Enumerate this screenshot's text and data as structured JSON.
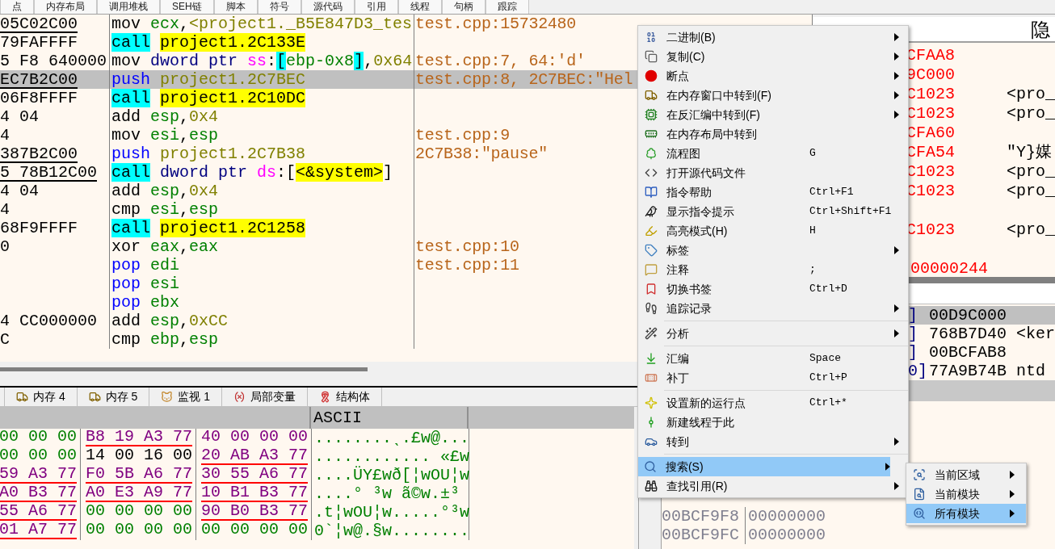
{
  "top_tabs": [
    {
      "label": "点"
    },
    {
      "label": "内存布局"
    },
    {
      "label": "调用堆栈"
    },
    {
      "label": "SEH链"
    },
    {
      "label": "脚本"
    },
    {
      "label": "符号"
    },
    {
      "label": "源代码"
    },
    {
      "label": "引用"
    },
    {
      "label": "线程"
    },
    {
      "label": "句柄"
    },
    {
      "label": "跟踪"
    }
  ],
  "disassembly": [
    {
      "bytes": "05C02C00",
      "underlined": true,
      "selected": false,
      "comment": "test.cpp:15732480",
      "parts": [
        {
          "text": "mov ",
          "kind": "op"
        },
        {
          "text": "ecx",
          "kind": "reg"
        },
        {
          "text": ",",
          "kind": "punct"
        },
        {
          "text": "<project1._B5E847D3_tes",
          "kind": "sym"
        }
      ]
    },
    {
      "bytes": "79FAFFFF",
      "underlined": false,
      "selected": false,
      "parts": [
        {
          "text": "call",
          "kind": "call"
        },
        {
          "text": "project1.2C133E",
          "kind": "target"
        }
      ]
    },
    {
      "bytes": "5 F8 640000",
      "underlined": false,
      "selected": false,
      "comment": "test.cpp:7, 64:'d'",
      "parts": [
        {
          "text": "mov ",
          "kind": "op"
        },
        {
          "text": "dword ptr ",
          "kind": "size"
        },
        {
          "text": "ss",
          "kind": "seg"
        },
        {
          "text": ":",
          "kind": "punct"
        },
        {
          "text": "[",
          "kind": "hl"
        },
        {
          "text": "ebp-0x8",
          "kind": "reg"
        },
        {
          "text": "]",
          "kind": "hl"
        },
        {
          "text": ",",
          "kind": "punct"
        },
        {
          "text": "0x64",
          "kind": "num"
        }
      ]
    },
    {
      "bytes": "EC7B2C00",
      "underlined": true,
      "selected": true,
      "comment": "test.cpp:8, 2C7BEC:\"Hel",
      "parts": [
        {
          "text": "push ",
          "kind": "stack"
        },
        {
          "text": "project1.2C7BEC",
          "kind": "sym"
        }
      ]
    },
    {
      "bytes": "06F8FFFF",
      "underlined": false,
      "selected": false,
      "parts": [
        {
          "text": "call",
          "kind": "call"
        },
        {
          "text": "project1.2C10DC",
          "kind": "target"
        }
      ]
    },
    {
      "bytes": "4 04",
      "underlined": false,
      "selected": false,
      "parts": [
        {
          "text": "add ",
          "kind": "op"
        },
        {
          "text": "esp",
          "kind": "reg"
        },
        {
          "text": ",",
          "kind": "punct"
        },
        {
          "text": "0x4",
          "kind": "num"
        }
      ]
    },
    {
      "bytes": "4",
      "underlined": false,
      "selected": false,
      "comment": "test.cpp:9",
      "parts": [
        {
          "text": "mov ",
          "kind": "op"
        },
        {
          "text": "esi",
          "kind": "reg"
        },
        {
          "text": ",",
          "kind": "punct"
        },
        {
          "text": "esp",
          "kind": "reg"
        }
      ]
    },
    {
      "bytes": "387B2C00",
      "underlined": true,
      "selected": false,
      "comment": "2C7B38:\"pause\"",
      "parts": [
        {
          "text": "push ",
          "kind": "stack"
        },
        {
          "text": "project1.2C7B38",
          "kind": "sym"
        }
      ]
    },
    {
      "bytes": "5 78B12C00",
      "underlined": true,
      "selected": false,
      "parts": [
        {
          "text": "call",
          "kind": "call"
        },
        {
          "text": "dword ptr ",
          "kind": "size"
        },
        {
          "text": "ds",
          "kind": "seg"
        },
        {
          "text": ":[",
          "kind": "punct"
        },
        {
          "text": "<&system>",
          "kind": "target"
        },
        {
          "text": "]",
          "kind": "punct"
        }
      ]
    },
    {
      "bytes": "4 04",
      "underlined": false,
      "selected": false,
      "parts": [
        {
          "text": "add ",
          "kind": "op"
        },
        {
          "text": "esp",
          "kind": "reg"
        },
        {
          "text": ",",
          "kind": "punct"
        },
        {
          "text": "0x4",
          "kind": "num"
        }
      ]
    },
    {
      "bytes": "4",
      "underlined": false,
      "selected": false,
      "parts": [
        {
          "text": "cmp ",
          "kind": "op"
        },
        {
          "text": "esi",
          "kind": "reg"
        },
        {
          "text": ",",
          "kind": "punct"
        },
        {
          "text": "esp",
          "kind": "reg"
        }
      ]
    },
    {
      "bytes": "68F9FFFF",
      "underlined": false,
      "selected": false,
      "parts": [
        {
          "text": "call",
          "kind": "call"
        },
        {
          "text": "project1.2C1258",
          "kind": "target"
        }
      ]
    },
    {
      "bytes": "0",
      "underlined": false,
      "selected": false,
      "comment": "test.cpp:10",
      "parts": [
        {
          "text": "xor ",
          "kind": "op"
        },
        {
          "text": "eax",
          "kind": "reg"
        },
        {
          "text": ",",
          "kind": "punct"
        },
        {
          "text": "eax",
          "kind": "reg"
        }
      ]
    },
    {
      "selected": false,
      "comment": "test.cpp:11",
      "parts": [
        {
          "text": "pop ",
          "kind": "stack"
        },
        {
          "text": "edi",
          "kind": "reg"
        }
      ]
    },
    {
      "selected": false,
      "parts": [
        {
          "text": "pop ",
          "kind": "stack"
        },
        {
          "text": "esi",
          "kind": "reg"
        }
      ]
    },
    {
      "selected": false,
      "parts": [
        {
          "text": "pop ",
          "kind": "stack"
        },
        {
          "text": "ebx",
          "kind": "reg"
        }
      ]
    },
    {
      "bytes": "4 CC000000",
      "underlined": false,
      "selected": false,
      "parts": [
        {
          "text": "add ",
          "kind": "op"
        },
        {
          "text": "esp",
          "kind": "reg"
        },
        {
          "text": ",",
          "kind": "punct"
        },
        {
          "text": "0xCC",
          "kind": "num"
        }
      ]
    },
    {
      "bytes": "C",
      "underlined": false,
      "selected": false,
      "parts": [
        {
          "text": "cmp ",
          "kind": "op"
        },
        {
          "text": "ebp",
          "kind": "reg"
        },
        {
          "text": ",",
          "kind": "punct"
        },
        {
          "text": "esp",
          "kind": "reg"
        }
      ]
    }
  ],
  "dump_tabs": [
    {
      "label": "内存 4",
      "selected": false
    },
    {
      "label": "内存 5",
      "selected": false
    },
    {
      "label": "监视 1",
      "selected": false
    },
    {
      "label": "局部变量",
      "selected": false
    },
    {
      "label": "结构体",
      "selected": false
    }
  ],
  "dump": {
    "ascii_header": "ASCII",
    "rows": [
      {
        "groups": [
          {
            "text": "00 00 00",
            "kind": "zero"
          },
          {
            "text": "B8 19 A3 77",
            "kind": "pointer"
          },
          {
            "text": "40 00 00 00",
            "kind": "lead"
          }
        ],
        "ascii": "........ˎ.£w@..."
      },
      {
        "groups": [
          {
            "text": "00 00 00",
            "kind": "zero"
          },
          {
            "text": "14 00 16 00",
            "kind": "data"
          },
          {
            "text": "20 AB A3 77",
            "kind": "pointer"
          }
        ],
        "ascii": "............ «£w"
      },
      {
        "groups": [
          {
            "text": "59 A3 77",
            "kind": "pointer"
          },
          {
            "text": "F0 5B A6 77",
            "kind": "pointer"
          },
          {
            "text": "30 55 A6 77",
            "kind": "pointer"
          }
        ],
        "ascii": "....ÜY£wð[¦wOU¦w"
      },
      {
        "groups": [
          {
            "text": "A0 B3 77",
            "kind": "pointer"
          },
          {
            "text": "A0 E3 A9 77",
            "kind": "pointer"
          },
          {
            "text": "10 B1 B3 77",
            "kind": "pointer"
          }
        ],
        "ascii": "....° ³w ã©w.±³"
      },
      {
        "groups": [
          {
            "text": "55 A6 77",
            "kind": "pointer"
          },
          {
            "text": "00 00 00 00",
            "kind": "zero"
          },
          {
            "text": "90 B0 B3 77",
            "kind": "pointer"
          }
        ],
        "ascii": ".t¦wOU¦w.....°³w"
      },
      {
        "groups": [
          {
            "text": "01 A7 77",
            "kind": "pointer"
          },
          {
            "text": "00 00 00 00",
            "kind": "zero"
          },
          {
            "text": "00 00 00 00",
            "kind": "zero"
          }
        ],
        "ascii": "0`¦w@.§w........"
      }
    ]
  },
  "registers": {
    "header": "隐",
    "rows": [
      {
        "value": "CFAA8"
      },
      {
        "value": "9C000"
      },
      {
        "value": "C1023",
        "comment": "<pro_"
      },
      {
        "value": "C1023",
        "comment": "<pro_"
      },
      {
        "value": "CFA60"
      },
      {
        "value": "CFA54",
        "comment": "\"Y}媒"
      },
      {
        "value": "C1023",
        "comment": "<pro_"
      },
      {
        "value": "C1023",
        "comment": "<pro_"
      },
      {
        "blank": true
      },
      {
        "value": "C1023",
        "comment": "<pro_"
      },
      {
        "blank": true
      },
      {
        "value": "00000244"
      }
    ]
  },
  "stack_top": {
    "rows": [
      {
        "prefix": "]",
        "value": "00D9C000",
        "selected": true
      },
      {
        "prefix": "]",
        "value": "768B7D40",
        "comment": "<ker",
        "selected": false
      },
      {
        "prefix": "]",
        "value": "00BCFAB8",
        "selected": false
      },
      {
        "prefix": "0]",
        "value": "77A9B74B",
        "comment": "ntd",
        "selected": false
      }
    ]
  },
  "stack_bottom": {
    "rows": [
      {
        "address": "00BCF9F8",
        "value": "00000000"
      },
      {
        "address": "00BCF9FC",
        "value": "00000000"
      }
    ]
  },
  "context_menu": {
    "groups": [
      [
        {
          "label": "二进制(B)",
          "submenu": true,
          "selected": false
        },
        {
          "label": "复制(C)",
          "submenu": true,
          "selected": false
        },
        {
          "label": "断点",
          "submenu": true,
          "selected": false
        },
        {
          "label": "在内存窗口中转到(F)",
          "submenu": true,
          "selected": false
        },
        {
          "label": "在反汇编中转到(F)",
          "submenu": true,
          "selected": false
        },
        {
          "label": "在内存布局中转到",
          "submenu": false,
          "selected": false
        },
        {
          "label": "流程图",
          "shortcut": "G",
          "submenu": false,
          "selected": false
        },
        {
          "label": "打开源代码文件",
          "submenu": false,
          "selected": false
        },
        {
          "label": "指令帮助",
          "shortcut": "Ctrl+F1",
          "submenu": false,
          "selected": false
        },
        {
          "label": "显示指令提示",
          "shortcut": "Ctrl+Shift+F1",
          "submenu": false,
          "selected": false
        },
        {
          "label": "高亮模式(H)",
          "shortcut": "H",
          "submenu": false,
          "selected": false
        },
        {
          "label": "标签",
          "submenu": true,
          "selected": false
        },
        {
          "label": "注释",
          "shortcut": ";",
          "submenu": false,
          "selected": false
        },
        {
          "label": "切换书签",
          "shortcut": "Ctrl+D",
          "submenu": false,
          "selected": false
        },
        {
          "label": "追踪记录",
          "submenu": true,
          "selected": false
        }
      ],
      [
        {
          "label": "分析",
          "submenu": true,
          "selected": false
        }
      ],
      [
        {
          "label": "汇编",
          "shortcut": "Space",
          "submenu": false,
          "selected": false
        },
        {
          "label": "补丁",
          "shortcut": "Ctrl+P",
          "submenu": false,
          "selected": false
        }
      ],
      [
        {
          "label": "设置新的运行点",
          "shortcut": "Ctrl+*",
          "submenu": false,
          "selected": false
        },
        {
          "label": "新建线程于此",
          "submenu": false,
          "selected": false
        },
        {
          "label": "转到",
          "submenu": true,
          "selected": false
        }
      ],
      [
        {
          "label": "搜索(S)",
          "submenu": true,
          "selected": true
        },
        {
          "label": "查找引用(R)",
          "submenu": true,
          "selected": false
        }
      ]
    ]
  },
  "submenu": {
    "items": [
      {
        "label": "当前区域",
        "submenu": true,
        "selected": false
      },
      {
        "label": "当前模块",
        "submenu": true,
        "selected": false
      },
      {
        "label": "所有模块",
        "submenu": true,
        "selected": true
      }
    ]
  }
}
